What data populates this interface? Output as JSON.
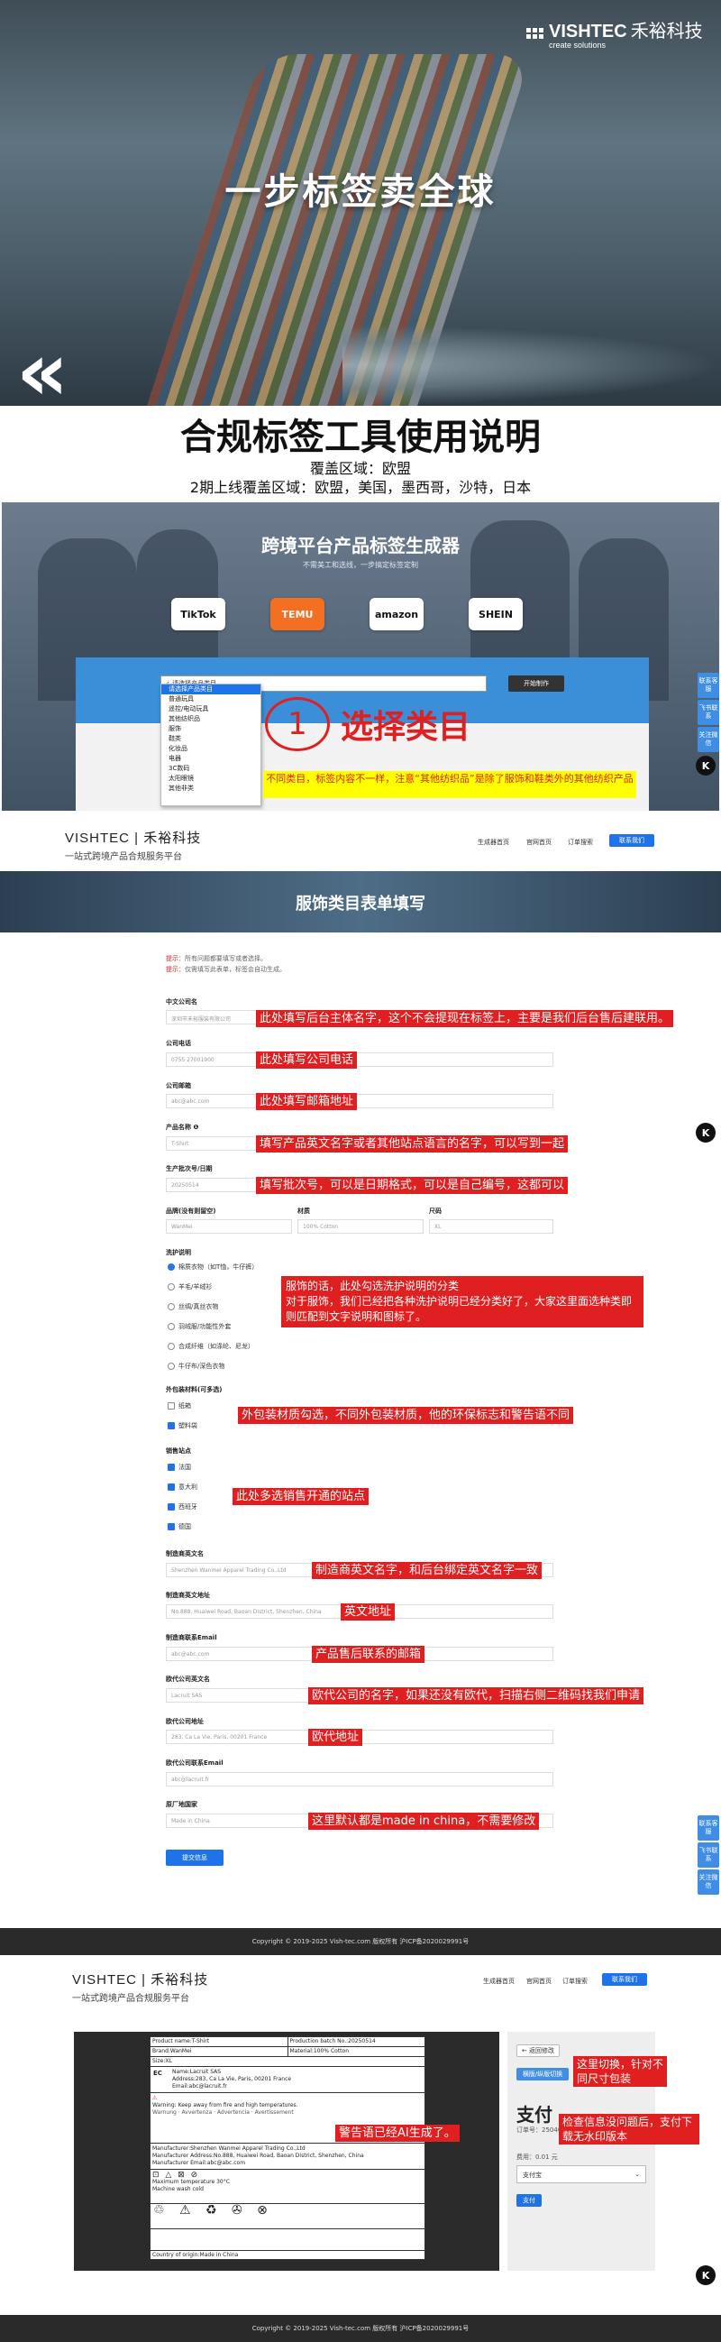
{
  "hero": {
    "brand_name": "VISHTEC",
    "brand_cn": "禾裕科技",
    "brand_tagline": "create solutions",
    "title": "一步标签卖全球",
    "back_symbol": "«"
  },
  "intro": {
    "title": "合规标签工具使用说明",
    "line1": "覆盖区域：欧盟",
    "line2": "2期上线覆盖区域：欧盟，美国，墨西哥，沙特，日本"
  },
  "screen1": {
    "title": "跨境平台产品标签生成器",
    "subtitle": "不需美工和选线，一步搞定标签定制",
    "platforms": [
      "TikTok",
      "TEMU",
      "amazon",
      "SHEIN"
    ],
    "dropdown_selected": "✓ 请选择产品类目",
    "dropdown_options": [
      "请选择产品类目",
      "普通玩具",
      "遥控/电动玩具",
      "其他纺织品",
      "服饰",
      "鞋类",
      "化妆品",
      "电器",
      "3C数码",
      "太阳眼镜",
      "其他非类"
    ],
    "start_button": "开始制作",
    "step_number": "1",
    "step_label": "选择类目",
    "note": "不同类目，标签内容不一样，注意“其他纺织品”是除了服饰和鞋类外的其他纺织产品"
  },
  "side_widgets": [
    "联系客服",
    "飞书联系",
    "关注微信"
  ],
  "k_button": "K",
  "nav": {
    "logo_line1": "VISHTEC | 禾裕科技",
    "logo_line2": "一站式跨境产品合规服务平台",
    "items": [
      "生成器首页",
      "官网首页",
      "订单搜索"
    ],
    "contact": "联系我们"
  },
  "form": {
    "banner_title": "服饰类目表单填写",
    "tip1_label": "提示：",
    "tip1": "所有问题都要填写或者选择。",
    "tip2_label": "提示：",
    "tip2": "仅需填写此表单，标签会自动生成。",
    "company_name_label": "中文公司名",
    "company_name_ph": "深圳市禾裕服装有限公司",
    "company_name_note": "此处填写后台主体名字，这个不会提现在标签上，主要是我们后台售后建联用。",
    "phone_label": "公司电话",
    "phone_ph": "0755 27001900",
    "phone_note": "此处填写公司电话",
    "email_label": "公司邮箱",
    "email_ph": "abc@abc.com",
    "email_note": "此处填写邮箱地址",
    "product_name_label": "产品名称 ❶",
    "product_name_ph": "T-Shirt",
    "product_name_note": "填写产品英文名字或者其他站点语言的名字，可以写到一起",
    "batch_label": "生产批次号/日期",
    "batch_ph": "20250514",
    "batch_note": "填写批次号，可以是日期格式，可以是自己编号，这都可以",
    "brand_label": "品牌(没有则留空)",
    "material_label": "材质",
    "size_label": "尺码",
    "brand_ph": "WanMei",
    "material_ph": "100% Cotton",
    "size_ph": "XL",
    "wash_label": "洗护说明",
    "wash_options": [
      "棉质衣物（如T恤，牛仔裤）",
      "羊毛/羊绒衫",
      "丝绸/真丝衣物",
      "羽绒服/功能性外套",
      "合成纤维（如涤纶、尼龙）",
      "牛仔布/深色衣物"
    ],
    "wash_note": "服饰的话，此处勾选洗护说明的分类\n对于服饰，我们已经把各种洗护说明已经分类好了，大家这里面选种类即则匹配到文字说明和图标了。",
    "pack_label": "外包装材料(可多选)",
    "pack_options": [
      "纸箱",
      "塑料袋"
    ],
    "pack_note": "外包装材质勾选，不同外包装材质，他的环保标志和警告语不同",
    "site_label": "销售站点",
    "site_options": [
      "法国",
      "意大利",
      "西班牙",
      "德国"
    ],
    "site_note": "此处多选销售开通的站点",
    "mfr_name_label": "制造商英文名",
    "mfr_name_ph": "Shenzhen Wanmei Apparel Trading Co.,Ltd",
    "mfr_name_note": "制造商英文名字，和后台绑定英文名字一致",
    "mfr_addr_label": "制造商英文地址",
    "mfr_addr_ph": "No.888, Huaiwei Road, Baoan District, Shenzhen, China",
    "mfr_addr_note": "英文地址",
    "mfr_email_label": "制造商联系Email",
    "mfr_email_ph": "abc@abc.com",
    "mfr_email_note": "产品售后联系的邮箱",
    "eu_name_label": "欧代公司英文名",
    "eu_name_ph": "Lacruit SAS",
    "eu_name_note": "欧代公司的名字，如果还没有欧代，扫描右侧二维码找我们申请",
    "eu_addr_label": "欧代公司地址",
    "eu_addr_ph": "283, Ca La Vie, Paris, 00201 France",
    "eu_addr_note": "欧代地址",
    "eu_email_label": "欧代公司联系Email",
    "eu_email_ph": "abc@lacruit.fr",
    "origin_label": "原厂地国家",
    "origin_ph": "Made in China",
    "origin_note": "这里默认都是made in china，不需要修改",
    "submit": "提交信息"
  },
  "footer": "Copyright © 2019-2025 Vish-tec.com 版权所有 沪ICP备2020029991号",
  "preview": {
    "back_btn": "← 返回修改",
    "size_btn": "横版/纵版切换",
    "switch_note": "这里切换，针对不同尺寸包装",
    "ai_note": "警告语已经AI生成了。",
    "pay_title": "支付",
    "order_label": "订单号：",
    "order_no": "2504091",
    "price_label": "费用：",
    "price": "0.01 元",
    "pay_select": "支付宝",
    "pay_btn": "支付",
    "pay_note": "检查信息没问题后，支付下载无水印版本",
    "label_lines": [
      "Product name:T-Shirt",
      "Production batch No.:20250514",
      "Brand:WanMei",
      "Material:100% Cotton",
      "Size:XL",
      "Name:Lacruit SAS",
      "Address:283, Ca La Vie, Paris, 00201 France",
      "Email:abc@lacruit.fr",
      "Warning: Keep away from fire and high temperatures.",
      "Manufacturer:Shenzhen Wanmei Apparel Trading Co.,Ltd",
      "Manufacturer Address:No.888, Huaiwei Road, Baoan District, Shenzhen, China",
      "Manufacturer Email:abc@abc.com",
      "Maximum temperature 30°C",
      "Machine wash cold",
      "Country of origin:Made in China"
    ]
  }
}
